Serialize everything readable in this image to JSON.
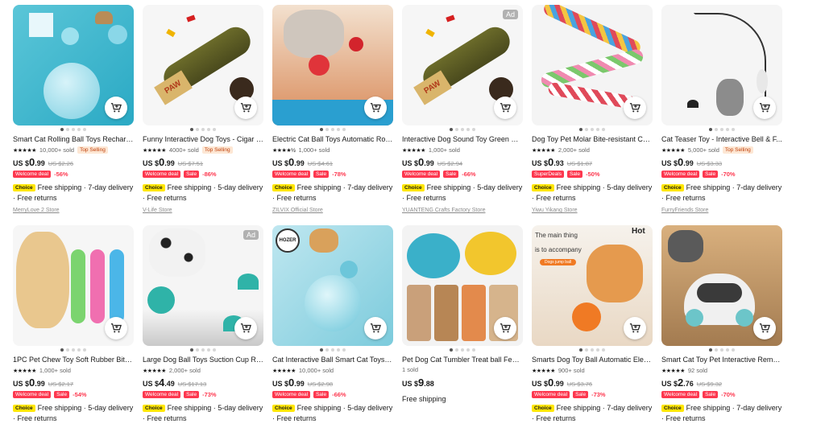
{
  "products": [
    {
      "title": "Smart Cat Rolling Ball Toys Recharg...",
      "stars": "★★★★★",
      "sold": "10,000+ sold",
      "badge": "Top Selling",
      "currency": "US $",
      "price_int": "0",
      "price_dec": ".99",
      "orig": "US $2.26",
      "tags": [
        "Welcome deal"
      ],
      "discount": "-56%",
      "shipping": "Free shipping · 7-day delivery · Free returns",
      "choice": "Choice",
      "store": "MerryLove 2 Store",
      "ad": "",
      "img": "cat-ball"
    },
    {
      "title": "Funny Interactive Dog Toys - Cigar D...",
      "stars": "★★★★★",
      "sold": "4000+ sold",
      "badge": "Top Selling",
      "currency": "US $",
      "price_int": "0",
      "price_dec": ".99",
      "orig": "US $7.51",
      "tags": [
        "Welcome deal",
        "Sale"
      ],
      "discount": "-86%",
      "shipping": "Free shipping · 5-day delivery · Free returns",
      "choice": "Choice",
      "store": "V-Life Store",
      "ad": "",
      "img": "cigar"
    },
    {
      "title": "Electric Cat Ball Toys Automatic Rolli...",
      "stars": "★★★★½",
      "sold": "1,000+ sold",
      "badge": "",
      "currency": "US $",
      "price_int": "0",
      "price_dec": ".99",
      "orig": "US $4.61",
      "tags": [
        "Welcome deal",
        "Sale"
      ],
      "discount": "-78%",
      "shipping": "Free shipping · 7-day delivery · Free returns",
      "choice": "Choice",
      "store": "ZILVIX Official Store",
      "ad": "",
      "img": "cat-red"
    },
    {
      "title": "Interactive Dog Sound Toy Green Si...",
      "stars": "★★★★★",
      "sold": "1,000+ sold",
      "badge": "",
      "currency": "US $",
      "price_int": "0",
      "price_dec": ".99",
      "orig": "US $2.94",
      "tags": [
        "Welcome deal",
        "Sale"
      ],
      "discount": "-66%",
      "shipping": "Free shipping · 5-day delivery · Free returns",
      "choice": "Choice",
      "store": "YUANTENG Crafts Factory Store",
      "ad": "Ad",
      "img": "cigar2"
    },
    {
      "title": "Dog Toy Pet Molar Bite-resistant Co...",
      "stars": "★★★★★",
      "sold": "2,000+ sold",
      "badge": "",
      "currency": "US $",
      "price_int": "0",
      "price_dec": ".93",
      "orig": "US $1.87",
      "tags": [
        "SuperDeals",
        "Sale"
      ],
      "discount": "-50%",
      "shipping": "Free shipping · 5-day delivery · Free returns",
      "choice": "Choice",
      "store": "Yiwu Yikang Store",
      "ad": "",
      "img": "rope"
    },
    {
      "title": "Cat Teaser Toy - Interactive Bell & F...",
      "stars": "★★★★★",
      "sold": "5,000+ sold",
      "badge": "Top Selling",
      "currency": "US $",
      "price_int": "0",
      "price_dec": ".99",
      "orig": "US $3.33",
      "tags": [
        "Welcome deal",
        "Sale"
      ],
      "discount": "-70%",
      "shipping": "Free shipping · 7-day delivery · Free returns",
      "choice": "Choice",
      "store": "FurryFriends Store",
      "ad": "",
      "img": "teaser"
    },
    {
      "title": "1PC Pet Chew Toy Soft Rubber Bite-...",
      "stars": "★★★★★",
      "sold": "1,000+ sold",
      "badge": "",
      "currency": "US $",
      "price_int": "0",
      "price_dec": ".99",
      "orig": "US $2.17",
      "tags": [
        "Welcome deal",
        "Sale"
      ],
      "discount": "-54%",
      "shipping": "Free shipping · 5-day delivery · Free returns",
      "choice": "Choice",
      "store": "",
      "ad": "",
      "img": "bones"
    },
    {
      "title": "Large Dog Ball Toys Suction Cup Ro...",
      "stars": "★★★★★",
      "sold": "2,000+ sold",
      "badge": "",
      "currency": "US $",
      "price_int": "4",
      "price_dec": ".49",
      "orig": "US $17.13",
      "tags": [
        "Welcome deal",
        "Sale"
      ],
      "discount": "-73%",
      "shipping": "Free shipping · 5-day delivery · Free returns",
      "choice": "Choice",
      "store": "",
      "ad": "Ad",
      "img": "suction"
    },
    {
      "title": "Cat Interactive Ball Smart Cat Toys I...",
      "stars": "★★★★★",
      "sold": "10,000+ sold",
      "badge": "",
      "currency": "US $",
      "price_int": "0",
      "price_dec": ".99",
      "orig": "US $2.98",
      "tags": [
        "Welcome deal",
        "Sale"
      ],
      "discount": "-66%",
      "shipping": "Free shipping · 5-day delivery · Free returns",
      "choice": "Choice",
      "store": "",
      "ad": "",
      "img": "cat-ball2"
    },
    {
      "title": "Pet Dog Cat Tumbler Treat ball Feed...",
      "stars": "",
      "sold": "1 sold",
      "badge": "",
      "currency": "US $",
      "price_int": "9",
      "price_dec": ".88",
      "orig": "",
      "tags": [],
      "discount": "",
      "shipping": "Free shipping",
      "choice": "",
      "store": "",
      "ad": "",
      "img": "tumbler"
    },
    {
      "title": "Smarts Dog Toy Ball Automatic Elect...",
      "stars": "★★★★★",
      "sold": "900+ sold",
      "badge": "",
      "currency": "US $",
      "price_int": "0",
      "price_dec": ".99",
      "orig": "US $3.76",
      "tags": [
        "Welcome deal",
        "Sale"
      ],
      "discount": "-73%",
      "shipping": "Free shipping · 7-day delivery · Free returns",
      "choice": "Choice",
      "store": "",
      "ad": "",
      "img": "corgi"
    },
    {
      "title": "Smart Cat Toy Pet Interactive Remot...",
      "stars": "★★★★★",
      "sold": "92 sold",
      "badge": "",
      "currency": "US $",
      "price_int": "2",
      "price_dec": ".76",
      "orig": "US $9.32",
      "tags": [
        "Welcome deal",
        "Sale"
      ],
      "discount": "-70%",
      "shipping": "Free shipping · 7-day delivery · Free returns",
      "choice": "Choice",
      "store": "",
      "ad": "",
      "img": "robot"
    }
  ],
  "image_texts": {
    "paw": "PAW",
    "hozer": "HOZER",
    "dog_jump": "Dogs jump ball",
    "main_thing": "The main thing",
    "accompany": "is to accompany",
    "hot": "Hot"
  },
  "icons": {
    "cart": "add-to-cart-icon"
  },
  "colors": {
    "sale_red": "#fd384f",
    "choice_yellow": "#ffe600",
    "top_selling_bg": "#fde7d4"
  }
}
